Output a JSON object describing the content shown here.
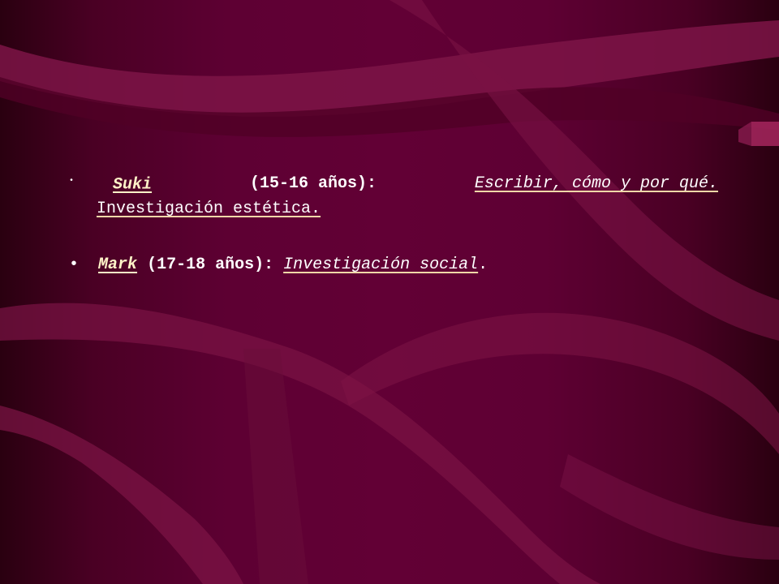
{
  "slide": {
    "items": [
      {
        "bullet": "•",
        "name": "Suki",
        "age": "(15-16 años):",
        "topic_line1": "Escribir, cómo y por qué.",
        "topic_line2": "Investigación estética."
      },
      {
        "bullet": "•",
        "name": "Mark",
        "age": "(17-18 años):",
        "topic": "Investigación social",
        "end": "."
      }
    ]
  },
  "colors": {
    "background": "#5e0033",
    "ribbon": "#8a1a4f",
    "name_text": "#fff2c8"
  }
}
